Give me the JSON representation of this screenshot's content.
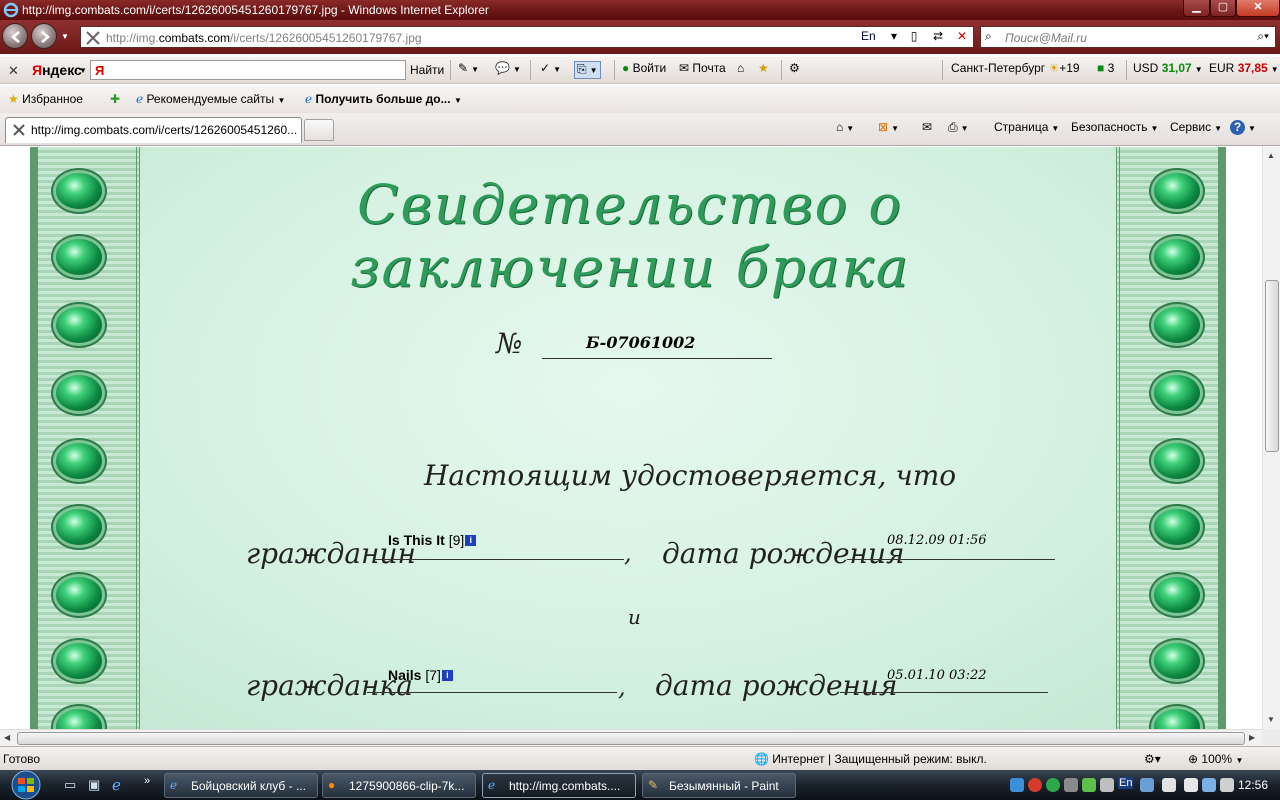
{
  "window": {
    "title": "http://img.combats.com/i/certs/12626005451260179767.jpg - Windows Internet Explorer"
  },
  "address_bar": {
    "url_prefix": "http://img.",
    "url_domain": "combats.com",
    "url_suffix": "/i/certs/12626005451260179767.jpg",
    "lang": "En",
    "search_placeholder": "Поиск@Mail.ru"
  },
  "yandex_bar": {
    "logo_letter": "Я",
    "logo_text": "ндекс",
    "input_prefix": "Я",
    "find_label": "Найти",
    "login_label": "Войти",
    "mail_label": "Почта",
    "city": "Санкт-Петербург",
    "temperature": "+19",
    "traffic_score": "3",
    "usd_label": "USD",
    "usd_rate": "31,07",
    "eur_label": "EUR",
    "eur_rate": "37,85"
  },
  "favorites_bar": {
    "favorites_label": "Избранное",
    "recommended_label": "Рекомендуемые сайты",
    "get_more_label": "Получить больше до..."
  },
  "tabs": [
    {
      "label": "http://img.combats.com/i/certs/12626005451260..."
    }
  ],
  "command_bar": {
    "page_label": "Страница",
    "safety_label": "Безопасность",
    "tools_label": "Сервис",
    "help_glyph": "?"
  },
  "certificate": {
    "title": "Свидетельство о заключении брака",
    "number_symbol": "№",
    "number": "Б-07061002",
    "certify_text": "Настоящим удостоверяется, что",
    "citizen_m_label": "гражданин",
    "citizen_m_name": "Is This It",
    "citizen_m_level": "[9]",
    "comma": ",",
    "birth_label": "дата рождения",
    "citizen_m_birth": "08.12.09 01:56",
    "and_text": "и",
    "citizen_f_label": "гражданка",
    "citizen_f_name": "Nails",
    "citizen_f_level": "[7]",
    "citizen_f_birth": "05.01.10 03:22",
    "info_glyph": "i"
  },
  "status_bar": {
    "status": "Готово",
    "zone": "Интернет | Защищенный режим: выкл.",
    "zoom": "100%"
  },
  "taskbar": {
    "tasks": [
      {
        "label": "Бойцовский клуб - ..."
      },
      {
        "label": "1275900866-clip-7k..."
      },
      {
        "label": "http://img.combats...."
      },
      {
        "label": "Безымянный - Paint"
      }
    ],
    "lang": "En",
    "clock": "12:56"
  },
  "colors": {
    "title_bar": "#6a1414",
    "certificate_green": "#2f9b5b",
    "gem_green": "#0d8a43"
  }
}
